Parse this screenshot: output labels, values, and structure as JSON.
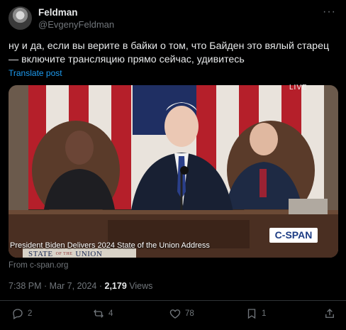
{
  "author": {
    "display_name": "Feldman",
    "handle": "@EvgenyFeldman"
  },
  "more_label": "···",
  "post": {
    "text": "ну и да, если вы верите в байки о том, что Байден это вялый старец — включите трансляцию прямо сейчас, удивитесь",
    "translate_label": "Translate post"
  },
  "media": {
    "live_label": "LIVE",
    "caption": "President Biden Delivers 2024 State of the Union Address",
    "network": "C-SPAN",
    "banner_left": "STATE",
    "banner_of": "OF THE",
    "banner_right": "UNION"
  },
  "source": "From c-span.org",
  "meta": {
    "time": "7:38 PM",
    "separator": " · ",
    "date": "Mar 7, 2024",
    "views_count": "2,179",
    "views_label": " Views"
  },
  "actions": {
    "replies": "2",
    "reposts": "4",
    "likes": "78",
    "bookmarks": "1"
  },
  "colors": {
    "background": "#000000",
    "text": "#e7e9ea",
    "muted": "#71767b",
    "link": "#1d9bf0"
  }
}
